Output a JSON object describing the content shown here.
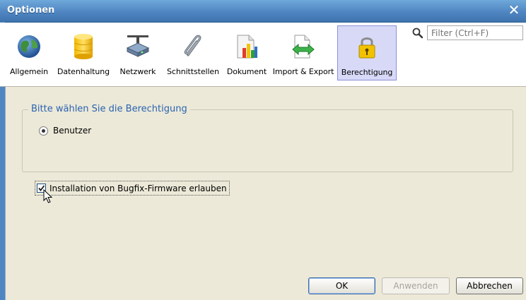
{
  "window": {
    "title": "Optionen",
    "close_glyph": "✕"
  },
  "toolbar": {
    "tabs": [
      {
        "label": "Allgemein",
        "icon": "globe-icon"
      },
      {
        "label": "Datenhaltung",
        "icon": "database-icon"
      },
      {
        "label": "Netzwerk",
        "icon": "network-icon"
      },
      {
        "label": "Schnittstellen",
        "icon": "paperclip-icon"
      },
      {
        "label": "Dokument",
        "icon": "document-chart-icon"
      },
      {
        "label": "Import & Export",
        "icon": "import-export-icon"
      },
      {
        "label": "Berechtigung",
        "icon": "padlock-icon",
        "selected": true
      }
    ],
    "filter_placeholder": "Filter (Ctrl+F)"
  },
  "permission_group": {
    "title": "Bitte wählen Sie die Berechtigung",
    "options": [
      {
        "label": "Benutzer",
        "selected": true
      }
    ]
  },
  "bugfix_checkbox": {
    "label": "Installation von Bugfix-Firmware erlauben",
    "checked": true
  },
  "buttons": {
    "ok": "OK",
    "apply": "Anwenden",
    "cancel": "Abbrechen"
  },
  "colors": {
    "titlebar": "#4F86C2",
    "selected_tab": "#D7D9F7",
    "legend_text": "#2A63B1"
  }
}
